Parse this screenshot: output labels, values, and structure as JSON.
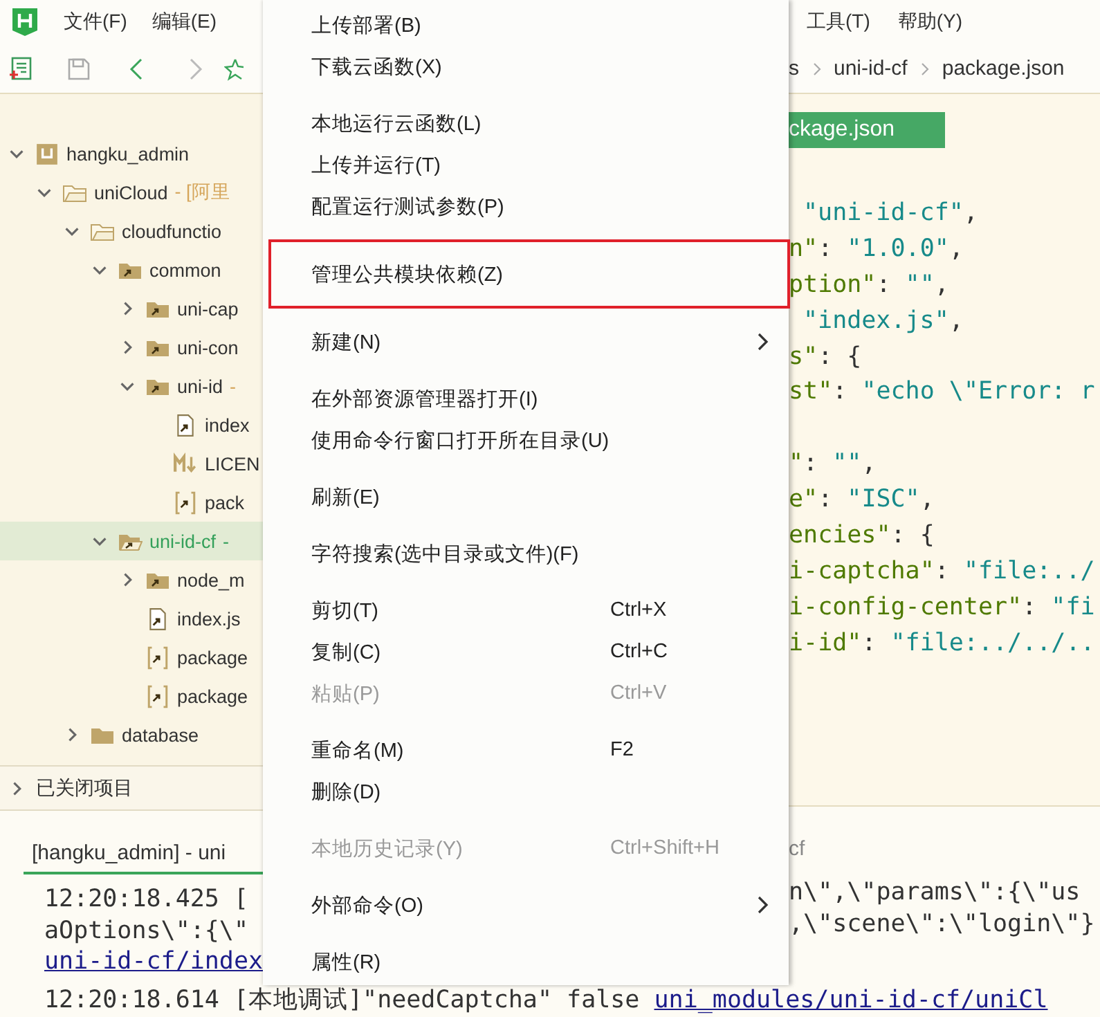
{
  "menubar": {
    "left": [
      "文件(F)",
      "编辑(E)"
    ],
    "right": [
      "工具(T)",
      "帮助(Y)"
    ]
  },
  "breadcrumb": [
    "s",
    "uni-id-cf",
    "package.json"
  ],
  "tree": [
    {
      "name": "hangku_admin",
      "kind": "project",
      "expanded": true,
      "selected": false,
      "children": [
        {
          "name": "uniCloud",
          "note": "- [阿里",
          "kind": "cloud-folder",
          "expanded": true,
          "selected": false,
          "children": [
            {
              "name": "cloudfunctio",
              "kind": "cloud-folder",
              "expanded": true,
              "selected": false,
              "children": [
                {
                  "name": "common",
                  "kind": "module-folder",
                  "expanded": true,
                  "selected": false,
                  "children": [
                    {
                      "name": "uni-cap",
                      "kind": "module-folder",
                      "expanded": false,
                      "selected": false
                    },
                    {
                      "name": "uni-con",
                      "kind": "module-folder",
                      "expanded": false,
                      "selected": false
                    },
                    {
                      "name": "uni-id",
                      "note": "-",
                      "kind": "module-folder",
                      "expanded": true,
                      "selected": false,
                      "children": [
                        {
                          "name": "index",
                          "kind": "file",
                          "selected": false
                        },
                        {
                          "name": "LICEN",
                          "kind": "markdown",
                          "selected": false
                        },
                        {
                          "name": "pack",
                          "kind": "json",
                          "selected": false
                        }
                      ]
                    }
                  ]
                },
                {
                  "name": "uni-id-cf",
                  "note": "-",
                  "kind": "module-folder-open",
                  "expanded": true,
                  "selected": true,
                  "children": [
                    {
                      "name": "node_m",
                      "kind": "module-folder",
                      "expanded": false,
                      "selected": false
                    },
                    {
                      "name": "index.js",
                      "kind": "file",
                      "selected": false
                    },
                    {
                      "name": "package",
                      "kind": "json",
                      "selected": false
                    },
                    {
                      "name": "package",
                      "kind": "json",
                      "selected": false
                    }
                  ]
                }
              ]
            },
            {
              "name": "database",
              "kind": "folder",
              "expanded": false,
              "selected": false
            }
          ]
        }
      ]
    }
  ],
  "closed_projects": {
    "label": "已关闭项目",
    "expanded": false
  },
  "editor": {
    "tab": "ckage.json",
    "lines": [
      {
        "kind": "code",
        "indented": true,
        "segments": [
          {
            "kind": "string",
            "text": "\"uni-id-cf\""
          },
          {
            "kind": "punct",
            "text": ","
          }
        ]
      },
      {
        "kind": "code",
        "segments": [
          {
            "kind": "key",
            "text": "n\""
          },
          {
            "kind": "punct",
            "text": ": "
          },
          {
            "kind": "string",
            "text": "\"1.0.0\""
          },
          {
            "kind": "punct",
            "text": ","
          }
        ]
      },
      {
        "kind": "code",
        "segments": [
          {
            "kind": "key",
            "text": "ption\""
          },
          {
            "kind": "punct",
            "text": ": "
          },
          {
            "kind": "string",
            "text": "\"\""
          },
          {
            "kind": "punct",
            "text": ","
          }
        ]
      },
      {
        "kind": "code",
        "indented": true,
        "segments": [
          {
            "kind": "string",
            "text": "\"index.js\""
          },
          {
            "kind": "punct",
            "text": ","
          }
        ]
      },
      {
        "kind": "code",
        "segments": [
          {
            "kind": "key",
            "text": "s\""
          },
          {
            "kind": "punct",
            "text": ": {"
          }
        ]
      },
      {
        "kind": "code",
        "segments": [
          {
            "kind": "key",
            "text": "st\""
          },
          {
            "kind": "punct",
            "text": ": "
          },
          {
            "kind": "string",
            "text": "\"echo \\\"Error: r"
          }
        ]
      },
      {
        "kind": "blank"
      },
      {
        "kind": "code",
        "segments": [
          {
            "kind": "key",
            "text": "\""
          },
          {
            "kind": "punct",
            "text": ": "
          },
          {
            "kind": "string",
            "text": "\"\""
          },
          {
            "kind": "punct",
            "text": ","
          }
        ]
      },
      {
        "kind": "code",
        "segments": [
          {
            "kind": "key",
            "text": "e\""
          },
          {
            "kind": "punct",
            "text": ": "
          },
          {
            "kind": "string",
            "text": "\"ISC\""
          },
          {
            "kind": "punct",
            "text": ","
          }
        ]
      },
      {
        "kind": "code",
        "segments": [
          {
            "kind": "key",
            "text": "encies\""
          },
          {
            "kind": "punct",
            "text": ": {"
          }
        ]
      },
      {
        "kind": "code",
        "segments": [
          {
            "kind": "key",
            "text": "i-captcha\""
          },
          {
            "kind": "punct",
            "text": ": "
          },
          {
            "kind": "string",
            "text": "\"file:../"
          }
        ]
      },
      {
        "kind": "code",
        "segments": [
          {
            "kind": "key",
            "text": "i-config-center\""
          },
          {
            "kind": "punct",
            "text": ": "
          },
          {
            "kind": "string",
            "text": "\"fi"
          }
        ]
      },
      {
        "kind": "code",
        "segments": [
          {
            "kind": "key",
            "text": "i-id\""
          },
          {
            "kind": "punct",
            "text": ": "
          },
          {
            "kind": "string",
            "text": "\"file:../../.."
          }
        ]
      }
    ]
  },
  "console": {
    "tab_left": "[hangku_admin] - uni",
    "tab_right": "cf",
    "left_lines": [
      {
        "kind": "text",
        "text": "12:20:18.425 ["
      },
      {
        "kind": "text",
        "text": "aOptions\\\":{\\\""
      },
      {
        "kind": "link",
        "text": "uni-id-cf/index"
      }
    ],
    "right_lines": [
      {
        "kind": "text",
        "text": "n\\\",\\\"params\\\":{\\\"us"
      },
      {
        "kind": "text",
        "text": ",\\\"scene\\\":\\\"login\\\"}"
      }
    ],
    "last_line": [
      {
        "kind": "text",
        "text": "12:20:18.614 [本地调试]\"needCaptcha\" false "
      },
      {
        "kind": "link",
        "text": "uni_modules/uni-id-cf/uniCl"
      }
    ]
  },
  "context_menu": {
    "groups": [
      [
        {
          "label": "上传部署(B)",
          "disabled": false,
          "highlighted": false
        },
        {
          "label": "下载云函数(X)",
          "disabled": false,
          "highlighted": false
        }
      ],
      [
        {
          "label": "本地运行云函数(L)",
          "disabled": false,
          "highlighted": false
        },
        {
          "label": "上传并运行(T)",
          "disabled": false,
          "highlighted": false
        },
        {
          "label": "配置运行测试参数(P)",
          "disabled": false,
          "highlighted": false
        }
      ],
      [
        {
          "label": "管理公共模块依赖(Z)",
          "disabled": false,
          "highlighted": true
        }
      ],
      [
        {
          "label": "新建(N)",
          "disabled": false,
          "highlighted": false,
          "submenu": true
        }
      ],
      [
        {
          "label": "在外部资源管理器打开(I)",
          "disabled": false,
          "highlighted": false
        },
        {
          "label": "使用命令行窗口打开所在目录(U)",
          "disabled": false,
          "highlighted": false
        }
      ],
      [
        {
          "label": "刷新(E)",
          "disabled": false,
          "highlighted": false
        }
      ],
      [
        {
          "label": "字符搜索(选中目录或文件)(F)",
          "disabled": false,
          "highlighted": false
        }
      ],
      [
        {
          "label": "剪切(T)",
          "shortcut": "Ctrl+X",
          "disabled": false,
          "highlighted": false
        },
        {
          "label": "复制(C)",
          "shortcut": "Ctrl+C",
          "disabled": false,
          "highlighted": false
        },
        {
          "label": "粘贴(P)",
          "shortcut": "Ctrl+V",
          "disabled": true,
          "highlighted": false
        }
      ],
      [
        {
          "label": "重命名(M)",
          "shortcut": "F2",
          "disabled": false,
          "highlighted": false
        },
        {
          "label": "删除(D)",
          "disabled": false,
          "highlighted": false
        }
      ],
      [
        {
          "label": "本地历史记录(Y)",
          "shortcut": "Ctrl+Shift+H",
          "disabled": true,
          "highlighted": false
        }
      ],
      [
        {
          "label": "外部命令(O)",
          "disabled": false,
          "highlighted": false,
          "submenu": true
        }
      ],
      [
        {
          "label": "属性(R)",
          "disabled": false,
          "highlighted": false
        }
      ]
    ]
  }
}
